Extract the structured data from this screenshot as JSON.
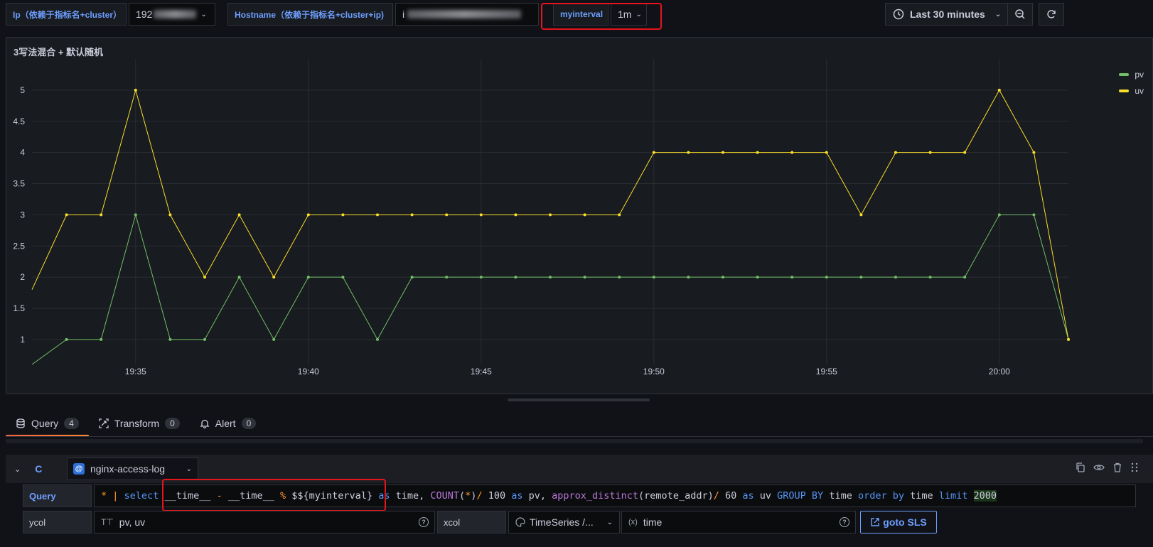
{
  "variables": {
    "ip_label": "Ip（依赖于指标名+cluster）",
    "ip_value_prefix": "192",
    "hostname_label": "Hostname（依赖于指标名+cluster+ip)",
    "hostname_value_prefix": "i",
    "myinterval_label": "myinterval",
    "myinterval_value": "1m"
  },
  "toolbar": {
    "time_range": "Last 30 minutes",
    "clock_icon": "clock-icon",
    "zoom_out_icon": "zoom-out-icon",
    "refresh_icon": "refresh-icon"
  },
  "panel": {
    "title": "3写法混合 + 默认随机"
  },
  "chart_data": {
    "type": "line",
    "x": [
      "19:32",
      "19:33",
      "19:34",
      "19:35",
      "19:36",
      "19:37",
      "19:38",
      "19:39",
      "19:40",
      "19:41",
      "19:42",
      "19:43",
      "19:44",
      "19:45",
      "19:46",
      "19:47",
      "19:48",
      "19:49",
      "19:50",
      "19:51",
      "19:52",
      "19:53",
      "19:54",
      "19:55",
      "19:56",
      "19:57",
      "19:58",
      "19:59",
      "20:00",
      "20:01",
      "20:02"
    ],
    "x_ticks": [
      "19:35",
      "19:40",
      "19:45",
      "19:50",
      "19:55",
      "20:00"
    ],
    "y_ticks": [
      "1",
      "1.5",
      "2",
      "2.5",
      "3",
      "3.5",
      "4",
      "4.5",
      "5"
    ],
    "ylim": [
      0.6,
      5.5
    ],
    "series": [
      {
        "name": "pv",
        "color": "#73bf69",
        "values": [
          0.6,
          1,
          1,
          3,
          1,
          1,
          2,
          1,
          2,
          2,
          1,
          2,
          2,
          2,
          2,
          2,
          2,
          2,
          2,
          2,
          2,
          2,
          2,
          2,
          2,
          2,
          2,
          2,
          3,
          3,
          1
        ]
      },
      {
        "name": "uv",
        "color": "#fade2a",
        "values": [
          1.8,
          3,
          3,
          5,
          3,
          2,
          3,
          2,
          3,
          3,
          3,
          3,
          3,
          3,
          3,
          3,
          3,
          3,
          4,
          4,
          4,
          4,
          4,
          4,
          3,
          4,
          4,
          4,
          5,
          4,
          1
        ]
      }
    ],
    "legend_position": "top-right",
    "grid": true
  },
  "tabs": [
    {
      "label": "Query",
      "count": "4",
      "icon": "database-icon"
    },
    {
      "label": "Transform",
      "count": "0",
      "icon": "transform-icon"
    },
    {
      "label": "Alert",
      "count": "0",
      "icon": "bell-icon"
    }
  ],
  "query_row": {
    "ref_id": "C",
    "datasource": "nginx-access-log",
    "query_label": "Query",
    "query_tokens": [
      {
        "t": "* ",
        "c": "tk-op"
      },
      {
        "t": "| ",
        "c": "tk-op"
      },
      {
        "t": "select ",
        "c": "tk-kw"
      },
      {
        "t": "__time__ ",
        "c": "tk-plain"
      },
      {
        "t": "- ",
        "c": "tk-op"
      },
      {
        "t": "__time__ ",
        "c": "tk-plain"
      },
      {
        "t": "% ",
        "c": "tk-op"
      },
      {
        "t": "$${myinterval} ",
        "c": "tk-var"
      },
      {
        "t": "as ",
        "c": "tk-kw"
      },
      {
        "t": "time, ",
        "c": "tk-plain"
      },
      {
        "t": "COUNT",
        "c": "tk-fn"
      },
      {
        "t": "(",
        "c": "tk-plain"
      },
      {
        "t": "*",
        "c": "tk-op"
      },
      {
        "t": ")",
        "c": "tk-plain"
      },
      {
        "t": "/ ",
        "c": "tk-op"
      },
      {
        "t": "100 ",
        "c": "tk-num"
      },
      {
        "t": "as ",
        "c": "tk-kw"
      },
      {
        "t": "pv, ",
        "c": "tk-plain"
      },
      {
        "t": "approx_distinct",
        "c": "tk-fn"
      },
      {
        "t": "(remote_addr)",
        "c": "tk-plain"
      },
      {
        "t": "/ ",
        "c": "tk-op"
      },
      {
        "t": "60 ",
        "c": "tk-num"
      },
      {
        "t": "as ",
        "c": "tk-kw"
      },
      {
        "t": "uv ",
        "c": "tk-plain"
      },
      {
        "t": "GROUP BY ",
        "c": "tk-kw"
      },
      {
        "t": "time ",
        "c": "tk-plain"
      },
      {
        "t": "order by ",
        "c": "tk-kw"
      },
      {
        "t": "time ",
        "c": "tk-plain"
      },
      {
        "t": "limit ",
        "c": "tk-kw"
      },
      {
        "t": "2000",
        "c": "tk-num tk-hl"
      }
    ],
    "ycol_label": "ycol",
    "ycol_value": "pv, uv",
    "xcol_label": "xcol",
    "xcol_format": "TimeSeries /...",
    "xcol_value": "time",
    "goto_label": "goto SLS"
  }
}
